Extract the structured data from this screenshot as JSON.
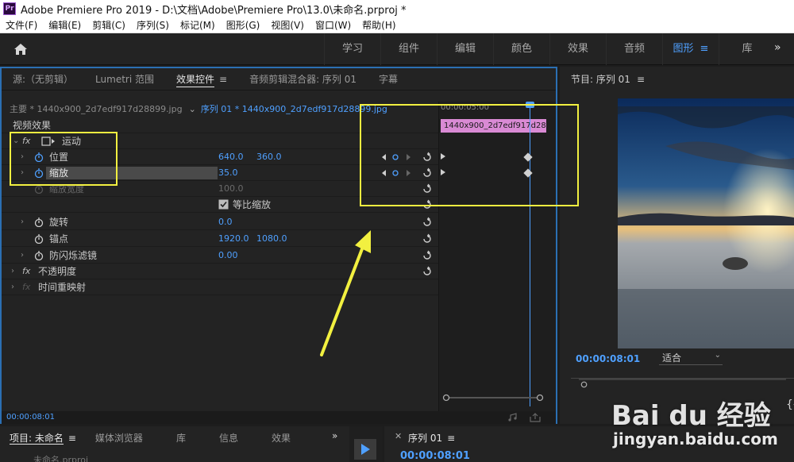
{
  "window": {
    "app_icon": "Pr",
    "title": "Adobe Premiere Pro 2019 - D:\\文档\\Adobe\\Premiere Pro\\13.0\\未命名.prproj *"
  },
  "menu": [
    "文件(F)",
    "编辑(E)",
    "剪辑(C)",
    "序列(S)",
    "标记(M)",
    "图形(G)",
    "视图(V)",
    "窗口(W)",
    "帮助(H)"
  ],
  "workspaces": {
    "tabs": [
      "学习",
      "组件",
      "编辑",
      "颜色",
      "效果",
      "音频",
      "图形",
      "库"
    ],
    "active": "图形",
    "more": "»"
  },
  "effect_panel": {
    "tabs": [
      "源:（无剪辑）",
      "Lumetri 范围",
      "效果控件",
      "音频剪辑混合器: 序列 01",
      "字幕"
    ],
    "active_tab": "效果控件",
    "master_label": "主要 * 1440x900_2d7edf917d28899.jpg",
    "sequence_label": "序列 01 * 1440x900_2d7edf917d28899.jpg",
    "section_video": "视频效果",
    "fx_label": "fx",
    "motion": "运动",
    "position_label": "位置",
    "position_x": "640.0",
    "position_y": "360.0",
    "scale_label": "缩放",
    "scale_value": "35.0",
    "scale_width_label": "缩放宽度",
    "scale_width_value": "100.0",
    "uniform_scale_label": "等比缩放",
    "rotation_label": "旋转",
    "rotation_value": "0.0",
    "anchor_label": "锚点",
    "anchor_x": "1920.0",
    "anchor_y": "1080.0",
    "anti_flicker_label": "防闪烁滤镜",
    "anti_flicker_value": "0.00",
    "opacity_label": "不透明度",
    "time_remap_label": "时间重映射",
    "timecode": "00:00:08:01",
    "ruler_tc": "00:00:05:00",
    "clip_name": "1440x900_2d7edf917d28899.jpg"
  },
  "program_monitor": {
    "title": "节目: 序列 01",
    "timecode": "00:00:08:01",
    "fit_label": "适合"
  },
  "project_panel": {
    "tabs": [
      "项目: 未命名",
      "媒体浏览器",
      "库",
      "信息",
      "效果"
    ],
    "file": "未命名.prproj",
    "more": "»"
  },
  "timeline_panel": {
    "title": "序列 01",
    "timecode": "00:00:08:01"
  },
  "watermark": {
    "logo": "Bai du 经验",
    "url": "jingyan.baidu.com"
  },
  "colors": {
    "accent": "#4fa0ff",
    "highlight": "#f2f040",
    "clip": "#d98ad4",
    "panel_border": "#2b6fb3"
  }
}
